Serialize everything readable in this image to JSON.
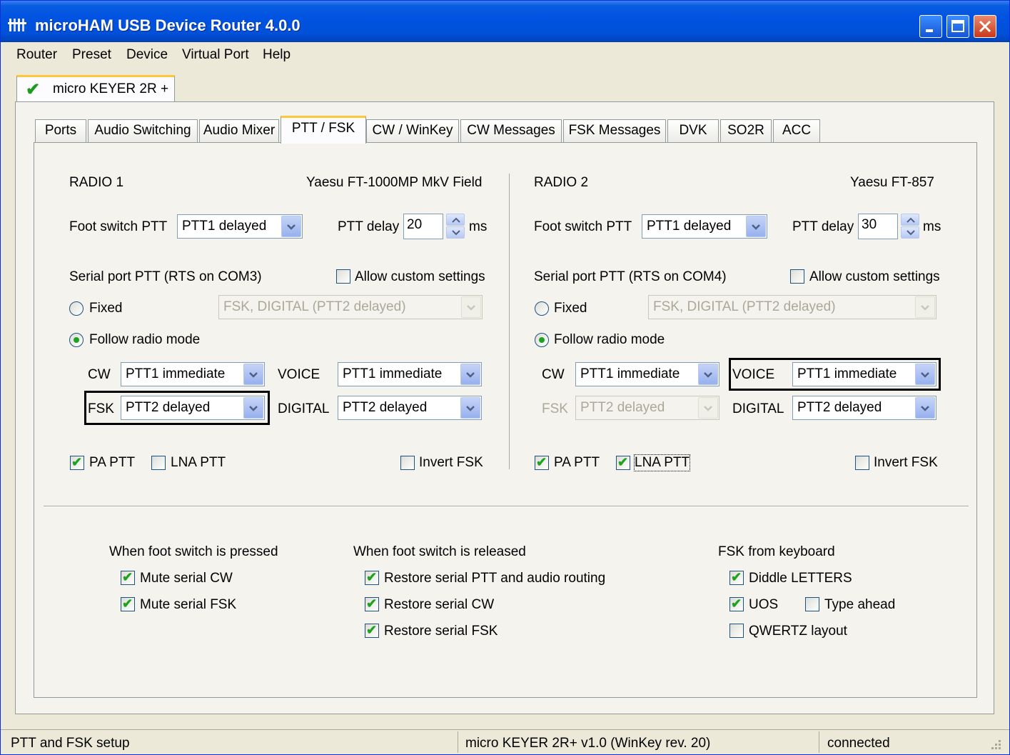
{
  "window": {
    "title": "microHAM USB Device Router 4.0.0",
    "icon": "app-icon"
  },
  "menu": [
    "Router",
    "Preset",
    "Device",
    "Virtual Port",
    "Help"
  ],
  "device_tab": {
    "label": "micro KEYER 2R +",
    "status_icon": "checkmark-icon"
  },
  "tabs": [
    "Ports",
    "Audio Switching",
    "Audio Mixer",
    "PTT / FSK",
    "CW / WinKey",
    "CW Messages",
    "FSK Messages",
    "DVK",
    "SO2R",
    "ACC"
  ],
  "active_tab": "PTT / FSK",
  "radio1": {
    "title": "RADIO 1",
    "model": "Yaesu FT-1000MP MkV Field",
    "foot_switch_label": "Foot switch PTT",
    "foot_switch_value": "PTT1 delayed",
    "ptt_delay_label": "PTT delay",
    "ptt_delay_value": "20",
    "ptt_delay_unit": "ms",
    "serial_label": "Serial port PTT (RTS on COM3)",
    "allow_custom_label": "Allow custom settings",
    "fixed_label": "Fixed",
    "fixed_value": "FSK, DIGITAL  (PTT2 delayed)",
    "follow_label": "Follow radio mode",
    "cw_label": "CW",
    "cw_value": "PTT1 immediate",
    "voice_label": "VOICE",
    "voice_value": "PTT1 immediate",
    "fsk_label": "FSK",
    "fsk_value": "PTT2 delayed",
    "digital_label": "DIGITAL",
    "digital_value": "PTT2 delayed",
    "pa_ptt_label": "PA PTT",
    "lna_ptt_label": "LNA PTT",
    "invert_fsk_label": "Invert FSK"
  },
  "radio2": {
    "title": "RADIO 2",
    "model": "Yaesu FT-857",
    "foot_switch_label": "Foot switch PTT",
    "foot_switch_value": "PTT1 delayed",
    "ptt_delay_label": "PTT delay",
    "ptt_delay_value": "30",
    "ptt_delay_unit": "ms",
    "serial_label": "Serial port PTT (RTS on COM4)",
    "allow_custom_label": "Allow custom settings",
    "fixed_label": "Fixed",
    "fixed_value": "FSK, DIGITAL  (PTT2 delayed)",
    "follow_label": "Follow radio mode",
    "cw_label": "CW",
    "cw_value": "PTT1 immediate",
    "voice_label": "VOICE",
    "voice_value": "PTT1 immediate",
    "fsk_label": "FSK",
    "fsk_value": "PTT2 delayed",
    "digital_label": "DIGITAL",
    "digital_value": "PTT2 delayed",
    "pa_ptt_label": "PA PTT",
    "lna_ptt_label": "LNA PTT",
    "invert_fsk_label": "Invert FSK"
  },
  "foot_pressed": {
    "title": "When foot switch is pressed",
    "items": [
      "Mute serial CW",
      "Mute serial FSK"
    ]
  },
  "foot_released": {
    "title": "When foot switch is released",
    "items": [
      "Restore serial PTT and audio routing",
      "Restore serial CW",
      "Restore serial FSK"
    ]
  },
  "fsk_keyboard": {
    "title": "FSK from keyboard",
    "diddle": "Diddle LETTERS",
    "uos": "UOS",
    "type_ahead": "Type ahead",
    "qwertz": "QWERTZ layout"
  },
  "status": {
    "left": "PTT and FSK setup",
    "center": "micro KEYER 2R+ v1.0 (WinKey rev. 20)",
    "right": "connected"
  },
  "colors": {
    "titlebar": "#0053e1",
    "check": "#21a121",
    "tab_highlight": "#ffc83c"
  }
}
